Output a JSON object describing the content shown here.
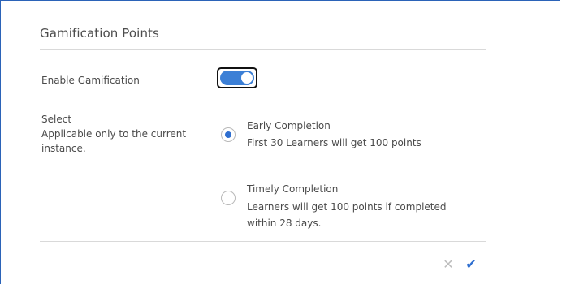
{
  "dialog": {
    "title": "Gamification Points",
    "enable_label": "Enable Gamification",
    "enable_state": true,
    "select_label": "Select\nApplicable only to the current instance.",
    "options": [
      {
        "title": "Early Completion",
        "description": "First 30 Learners will get 100 points",
        "selected": true
      },
      {
        "title": "Timely Completion",
        "description": "Learners will get 100 points if completed within 28 days.",
        "selected": false
      }
    ],
    "cancel_glyph": "✕",
    "confirm_glyph": "✔"
  },
  "colors": {
    "frame_border": "#2b63b8",
    "accent": "#2f6fd0",
    "toggle_track": "#3b7fd6",
    "divider": "#d9d9d9"
  },
  "icons": {
    "cancel": "close-icon",
    "confirm": "check-icon"
  }
}
